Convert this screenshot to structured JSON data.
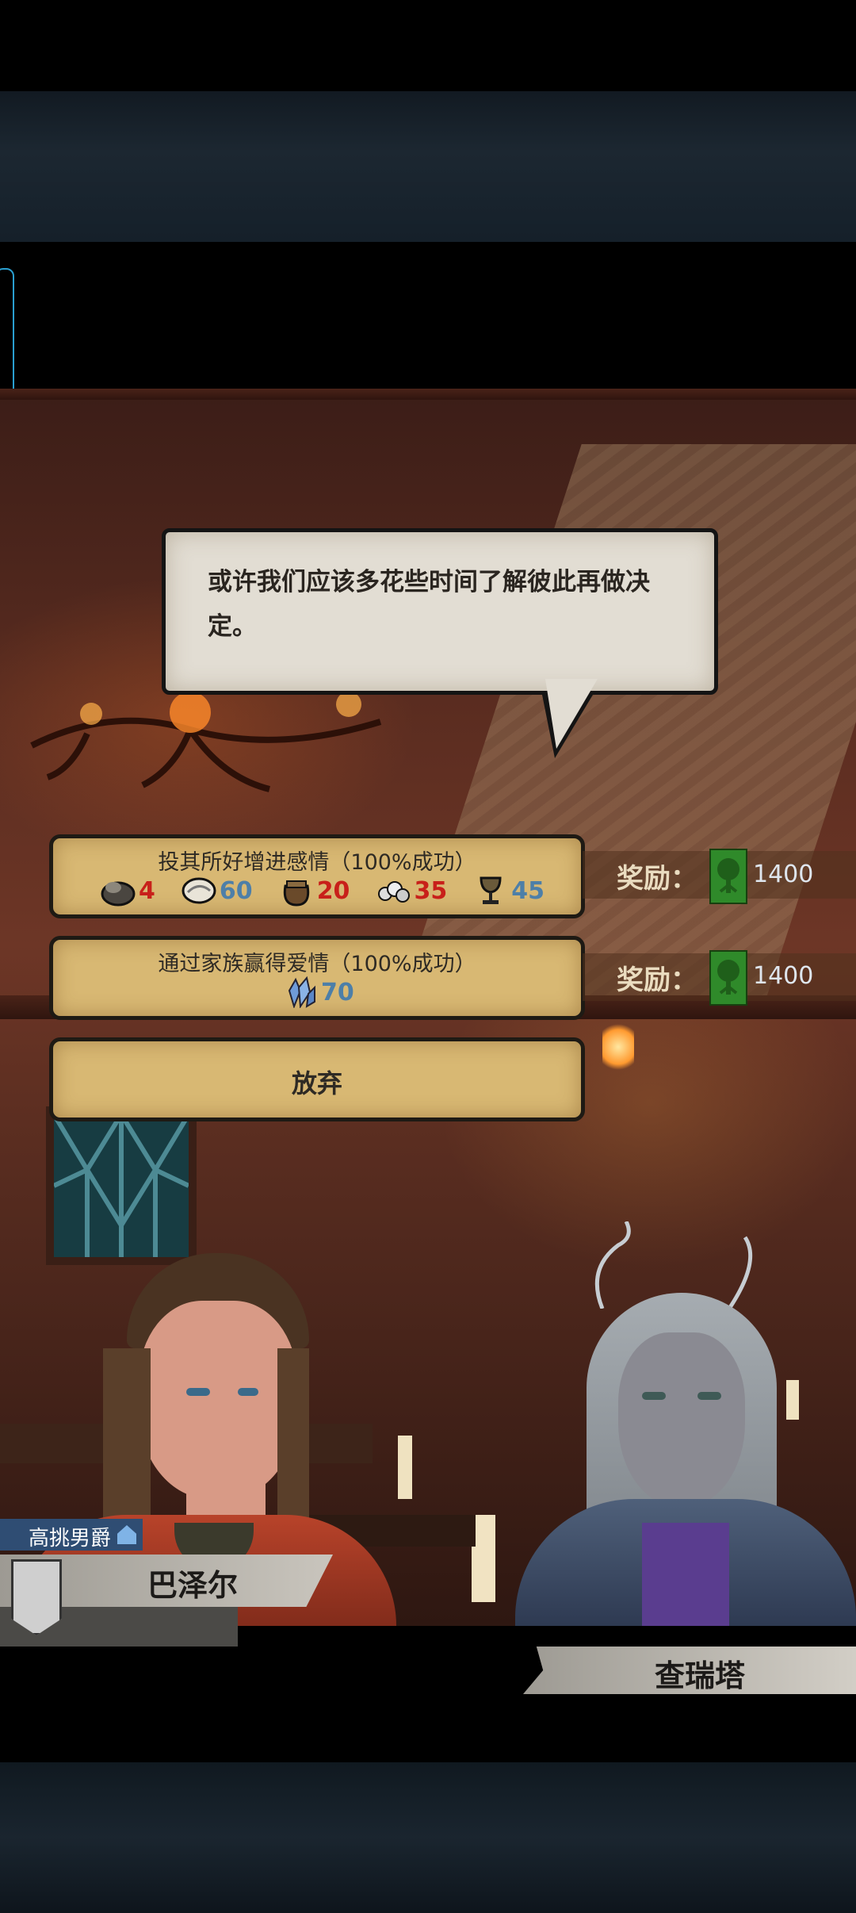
{
  "dialogue": {
    "text": "或许我们应该多花些时间了解彼此再做决定。"
  },
  "choices": [
    {
      "label": "投其所好增进感情（100%成功）",
      "costs": [
        {
          "icon": "stone-icon",
          "value": "4",
          "color": "#c8201a"
        },
        {
          "icon": "oyster-icon",
          "value": "60",
          "color": "#4d7fa8"
        },
        {
          "icon": "pot-icon",
          "value": "20",
          "color": "#c8201a"
        },
        {
          "icon": "pearls-icon",
          "value": "35",
          "color": "#c8201a"
        },
        {
          "icon": "goblet-icon",
          "value": "45",
          "color": "#4d7fa8"
        }
      ],
      "reward_label": "奖励：",
      "reward_value": "1400"
    },
    {
      "label": "通过家族赢得爱情（100%成功）",
      "costs": [
        {
          "icon": "crystal-icon",
          "value": "70",
          "color": "#4d7fa8"
        }
      ],
      "reward_label": "奖励：",
      "reward_value": "1400"
    },
    {
      "label": "放弃"
    }
  ],
  "characters": {
    "left": {
      "title": "高挑男爵",
      "name": "巴泽尔"
    },
    "right": {
      "name": "查瑞塔"
    }
  }
}
